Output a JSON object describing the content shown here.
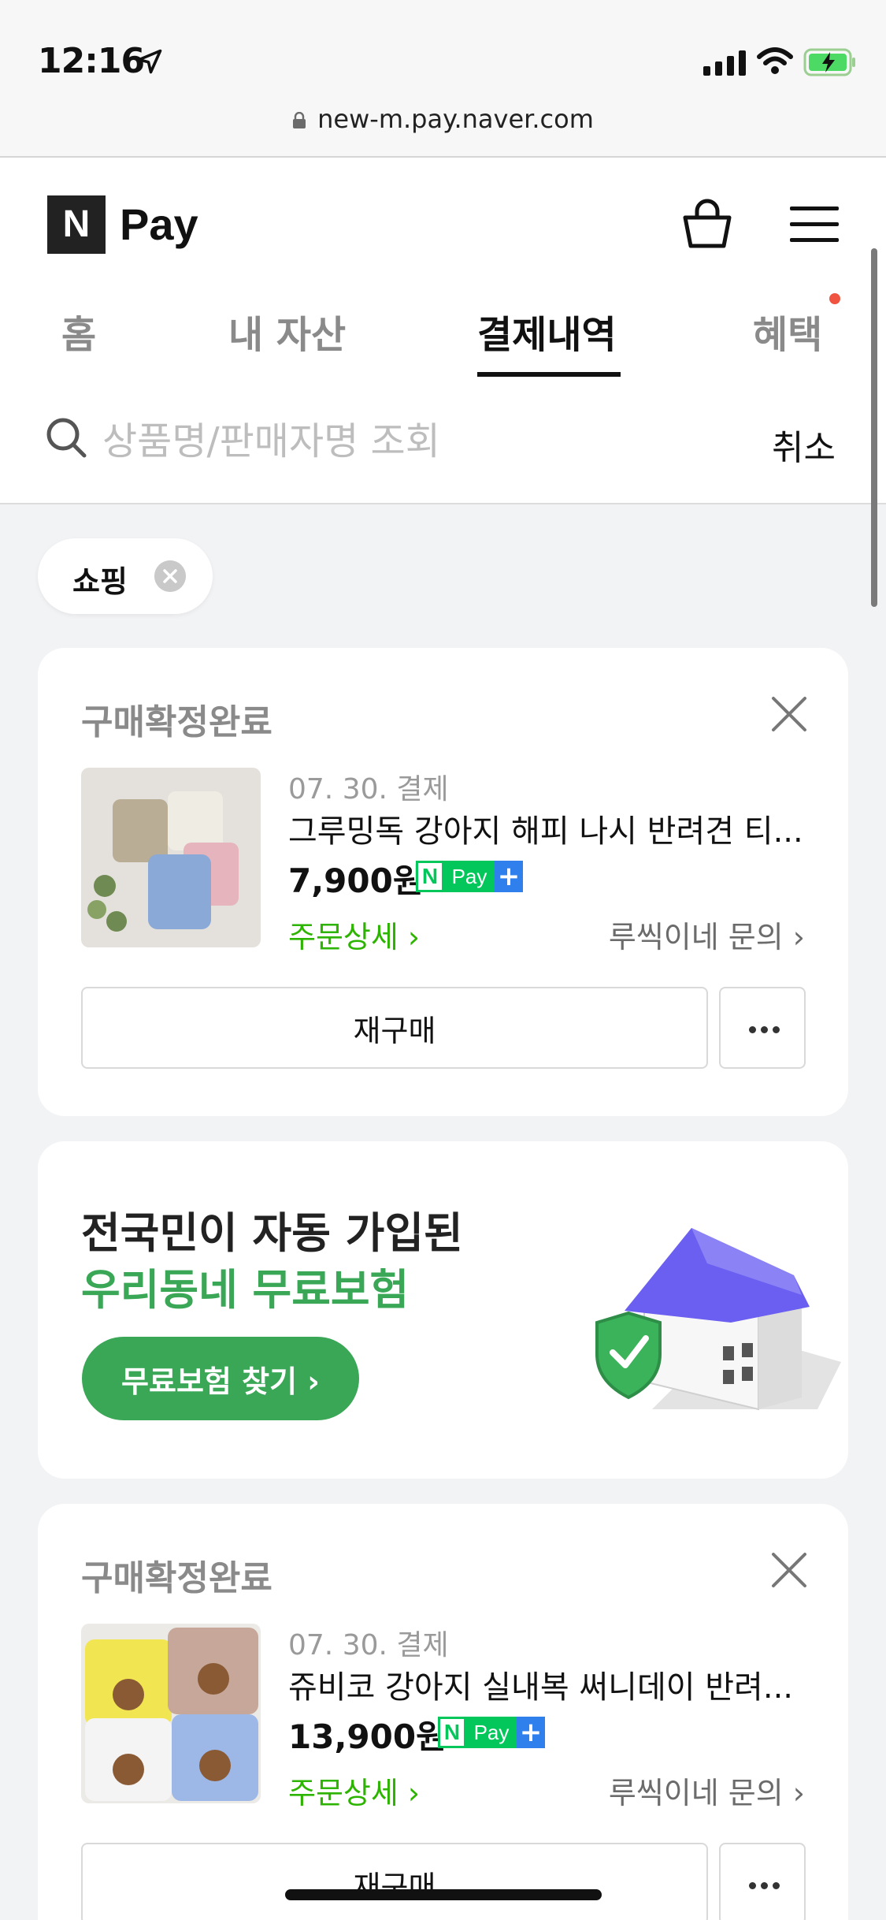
{
  "status_bar": {
    "time": "12:16",
    "url": "new-m.pay.naver.com"
  },
  "header": {
    "logo_mark": "N",
    "logo_text": "Pay",
    "icons": [
      "shopping-bag-icon",
      "hamburger-menu-icon"
    ]
  },
  "tabs": [
    {
      "label": "홈",
      "active": false
    },
    {
      "label": "내 자산",
      "active": false
    },
    {
      "label": "결제내역",
      "active": true
    },
    {
      "label": "혜택",
      "active": false,
      "has_notification_dot": true
    }
  ],
  "search": {
    "placeholder": "상품명/판매자명 조회",
    "value": "",
    "cancel_label": "취소"
  },
  "filter_chip": {
    "label": "쇼핑"
  },
  "orders": [
    {
      "status": "구매확정완료",
      "date": "07. 30. 결제",
      "product_name": "그루밍독 강아지 해피 나시 반려견 티...",
      "price": "7,900원",
      "badge": {
        "mark": "N",
        "text": "Pay",
        "plus": "+"
      },
      "order_detail_label": "주문상세 ›",
      "seller_inquiry_label": "루씩이네 문의 ›",
      "rebuy_label": "재구매"
    },
    {
      "status": "구매확정완료",
      "date": "07. 30. 결제",
      "product_name": "쥬비코 강아지 실내복 써니데이 반려...",
      "price": "13,900원",
      "badge": {
        "mark": "N",
        "text": "Pay",
        "plus": "+"
      },
      "order_detail_label": "주문상세 ›",
      "seller_inquiry_label": "루씩이네 문의 ›",
      "rebuy_label": "재구매"
    }
  ],
  "banner": {
    "line1": "전국민이 자동 가입된",
    "line2": "우리동네 무료보험",
    "button_label": "무료보험 찾기 ›"
  },
  "colors": {
    "naver_green": "#03c75a",
    "link_green": "#2db400",
    "banner_green": "#3aa757",
    "plus_blue": "#2f80ed",
    "notification_red": "#f0533f"
  }
}
